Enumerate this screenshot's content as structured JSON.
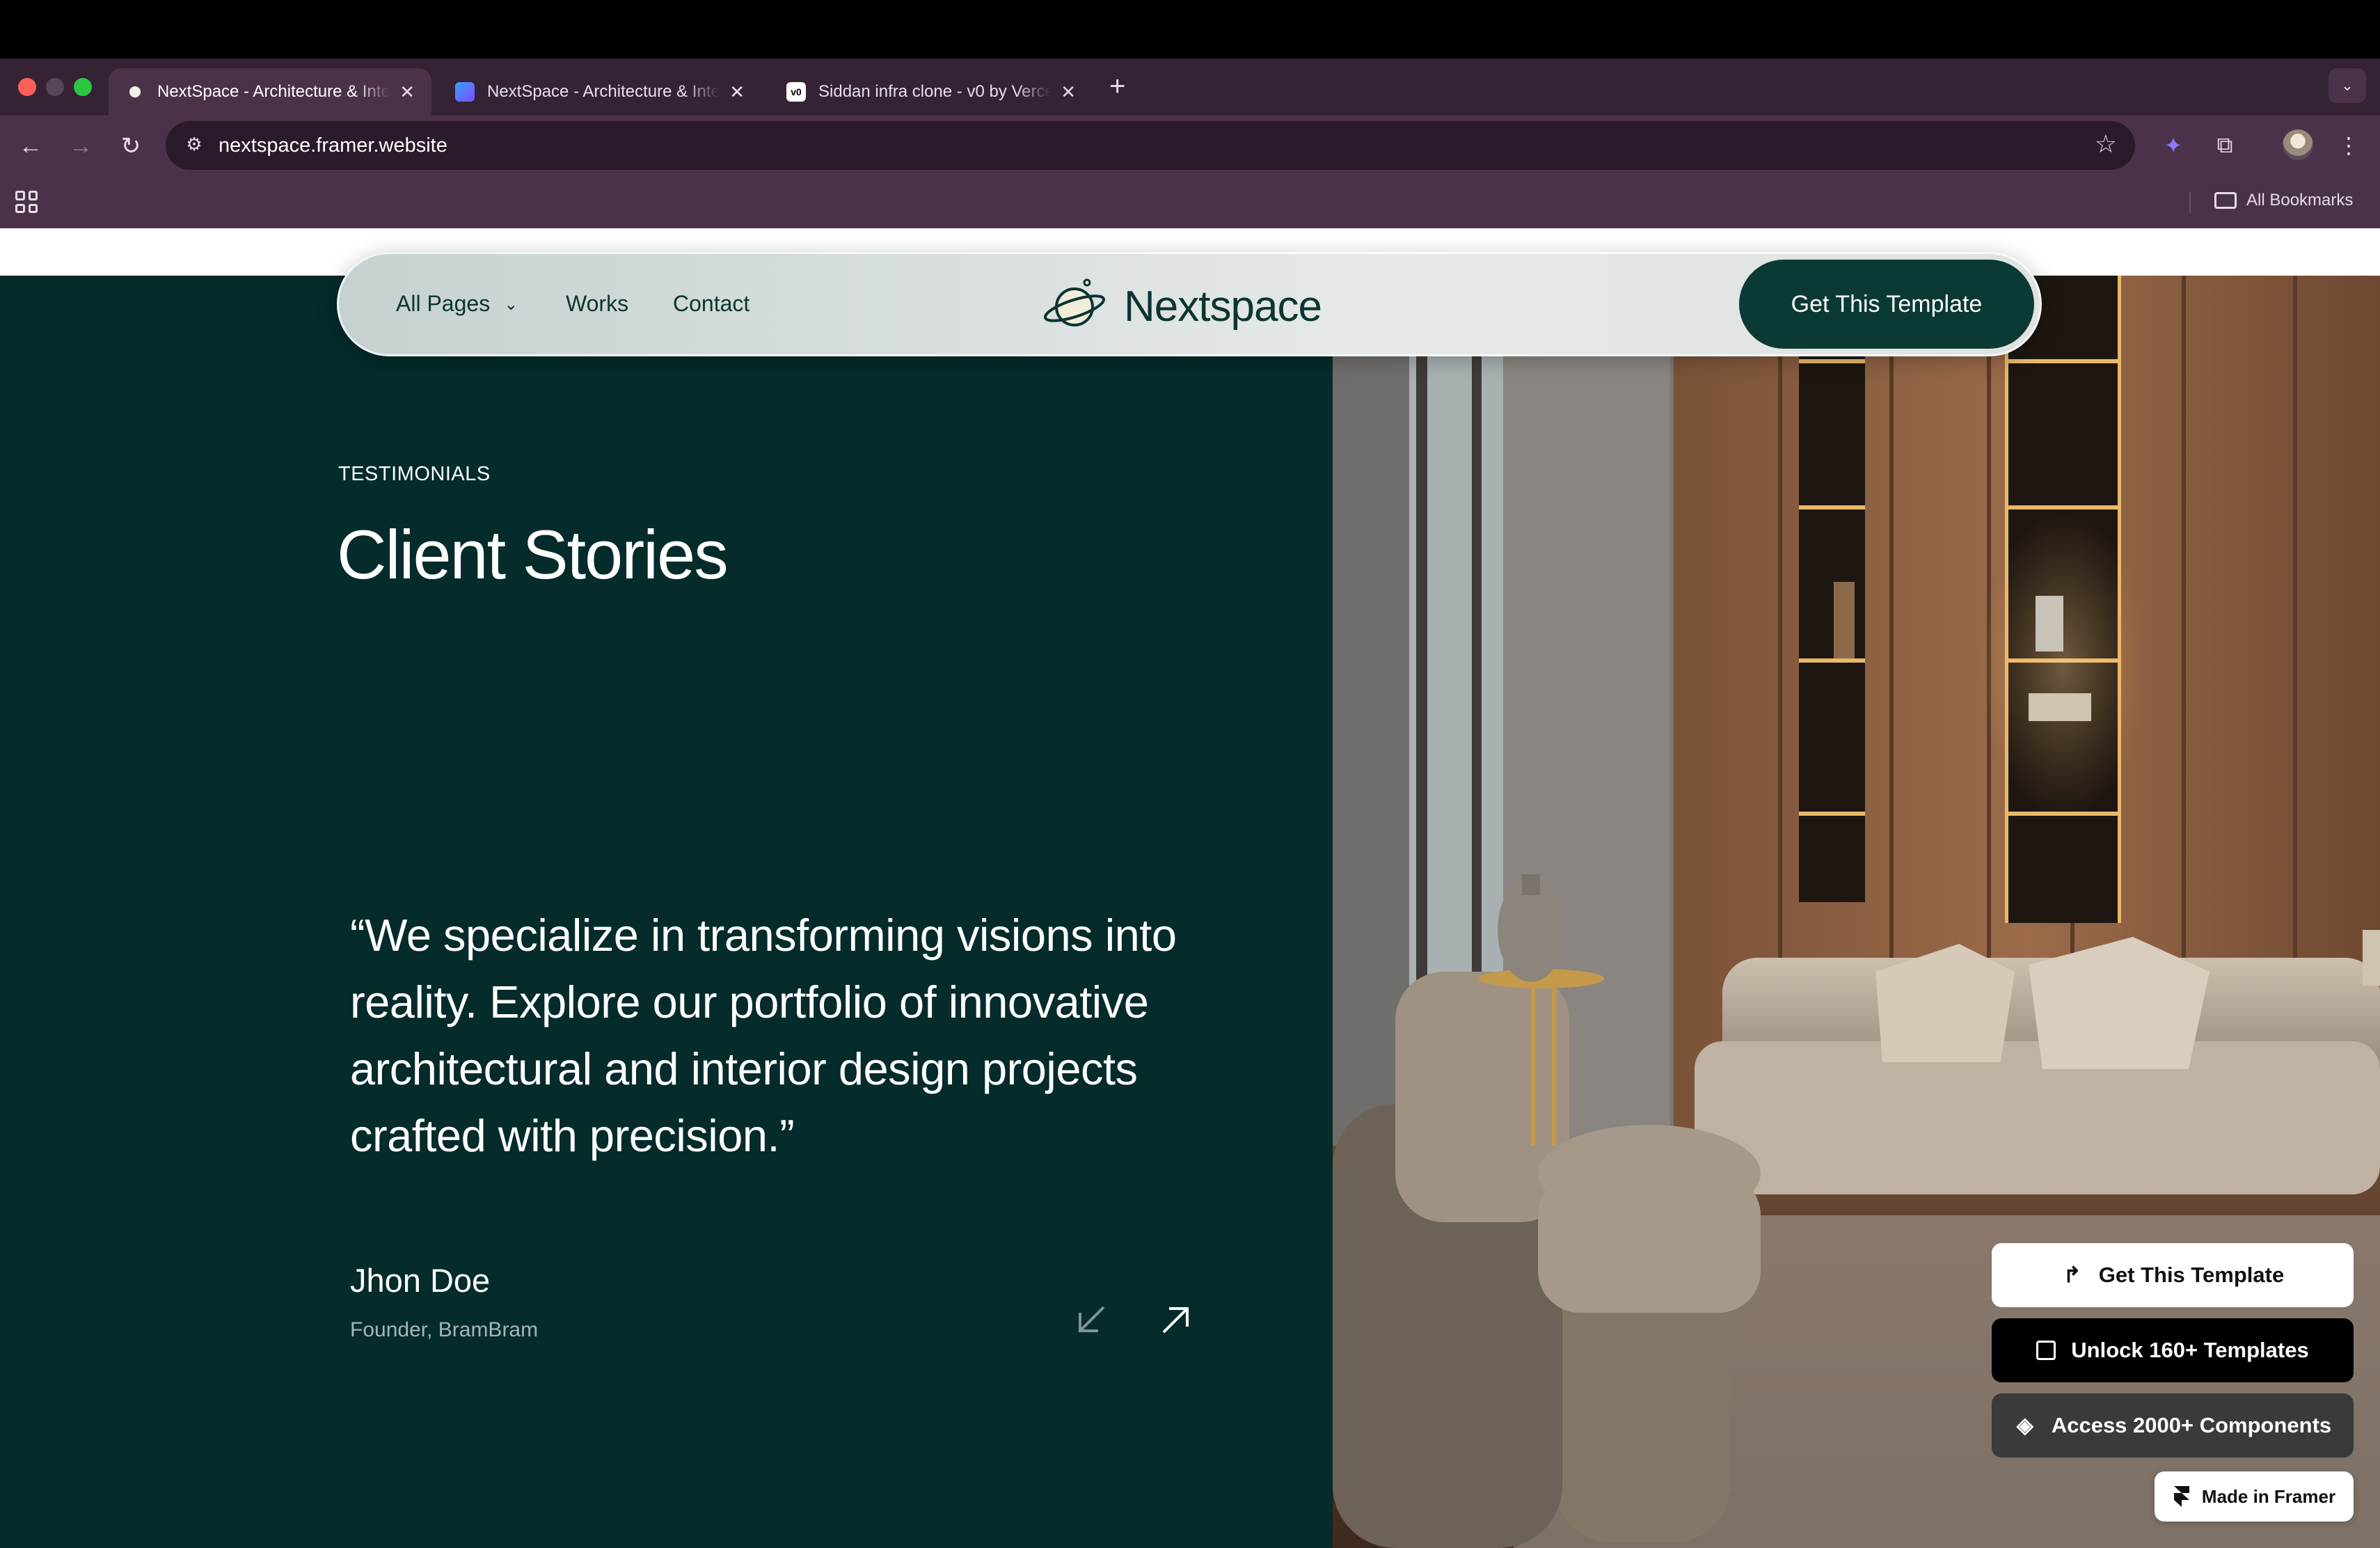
{
  "browser": {
    "tabs": [
      {
        "title": "NextSpace - Architecture & Interior",
        "close": "✕",
        "active": true
      },
      {
        "title": "NextSpace - Architecture & Interior",
        "close": "✕",
        "active": false
      },
      {
        "title": "Siddan infra clone - v0 by Vercel",
        "close": "✕",
        "active": false
      }
    ],
    "new_tab": "+",
    "tab_menu": "⌄",
    "url": "nextspace.framer.website",
    "bookmarks_label": "All Bookmarks"
  },
  "nav": {
    "items": [
      "All Pages",
      "Works",
      "Contact"
    ],
    "dropdown_glyph": "⌄",
    "brand": "Nextspace",
    "cta": "Get This Template"
  },
  "testimonial": {
    "eyebrow": "TESTIMONIALS",
    "title": "Client Stories",
    "quote": "“We specialize in transforming visions into reality. Explore our portfolio of innovative architectural and interior design projects crafted with precision.”",
    "author": "Jhon Doe",
    "role": "Founder, BramBram"
  },
  "framer_promo": {
    "get_template": "Get This Template",
    "unlock": "Unlock 160+ Templates",
    "components": "Access 2000+ Components",
    "made_in": "Made in Framer"
  },
  "colors": {
    "section_bg": "#052b2b",
    "brand_dark": "#0b3a35",
    "browser_frame": "#352235"
  }
}
